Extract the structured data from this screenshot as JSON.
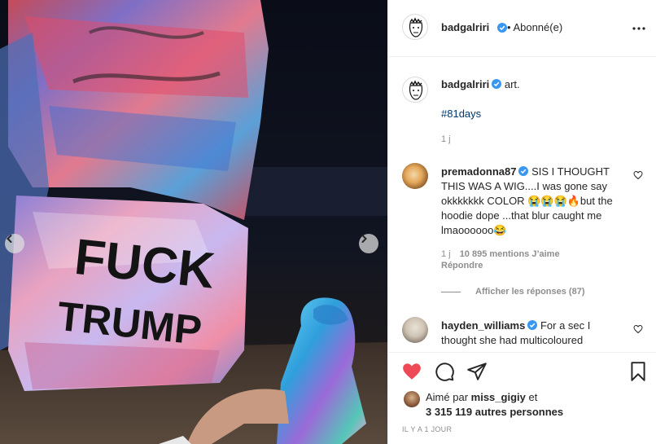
{
  "post": {
    "username": "badgalriri",
    "follow_state": "• Abonné(e)",
    "caption": "art.",
    "hashtag": "#81days",
    "caption_time": "1 j",
    "likes": {
      "liked_by_prefix": "Aimé par",
      "liked_by_user": "miss_gigiy",
      "and": "et",
      "others": "3 315 119 autres personnes"
    },
    "timestamp": "IL Y A 1 JOUR",
    "liked": true
  },
  "comments": [
    {
      "username": "premadonna87",
      "text": "SIS I THOUGHT THIS WAS A WIG....I was gone say okkkkkkk COLOR 😭😭😭🔥but the hoodie dope ...that blur caught me lmaoooooo😂",
      "time": "1 j",
      "likes": "10 895 mentions J’aime",
      "reply_label": "Répondre",
      "view_replies": "Afficher les réponses (87)"
    },
    {
      "username": "hayden_williams",
      "text": "For a sec I thought she had multicoloured"
    }
  ],
  "photo": {
    "graffiti_lines": [
      "FUCK",
      "TRUMP"
    ]
  },
  "icons": {
    "verified": "verified-badge-icon",
    "more": "more-options-icon",
    "like": "heart-icon",
    "comment": "comment-bubble-icon",
    "share": "paper-plane-icon",
    "save": "bookmark-icon"
  },
  "colors": {
    "like_red": "#ed4956",
    "verified_blue": "#3897f0",
    "link_blue": "#00376b",
    "muted": "#8e8e8e"
  }
}
